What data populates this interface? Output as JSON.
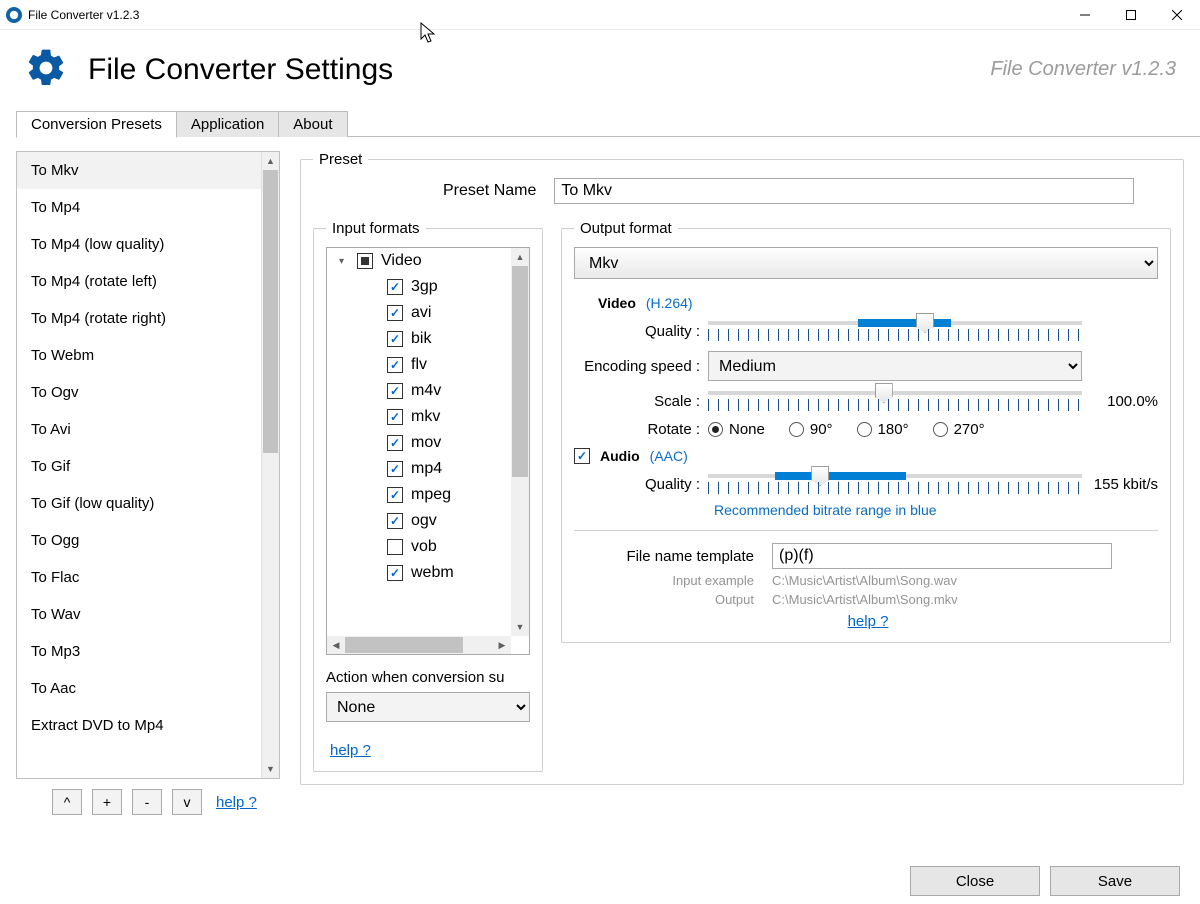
{
  "window": {
    "title": "File Converter v1.2.3"
  },
  "header": {
    "title": "File Converter Settings",
    "version": "File Converter v1.2.3"
  },
  "tabs": {
    "presets": "Conversion Presets",
    "application": "Application",
    "about": "About"
  },
  "presets": {
    "items": [
      "To Mkv",
      "To Mp4",
      "To Mp4 (low quality)",
      "To Mp4 (rotate left)",
      "To Mp4 (rotate right)",
      "To Webm",
      "To Ogv",
      "To Avi",
      "To Gif",
      "To Gif (low quality)",
      "To Ogg",
      "To Flac",
      "To Wav",
      "To Mp3",
      "To Aac",
      "Extract DVD to Mp4"
    ],
    "selected_index": 0,
    "buttons": {
      "up": "^",
      "add": "+",
      "remove": "-",
      "down": "v"
    },
    "help": "help ?"
  },
  "preset_box": {
    "legend": "Preset",
    "name_label": "Preset Name",
    "name_value": "To Mkv",
    "help": "help ?"
  },
  "input_formats": {
    "legend": "Input formats",
    "group": "Video",
    "items": [
      {
        "label": "3gp",
        "checked": true
      },
      {
        "label": "avi",
        "checked": true
      },
      {
        "label": "bik",
        "checked": true
      },
      {
        "label": "flv",
        "checked": true
      },
      {
        "label": "m4v",
        "checked": true
      },
      {
        "label": "mkv",
        "checked": true
      },
      {
        "label": "mov",
        "checked": true
      },
      {
        "label": "mp4",
        "checked": true
      },
      {
        "label": "mpeg",
        "checked": true
      },
      {
        "label": "ogv",
        "checked": true
      },
      {
        "label": "vob",
        "checked": false
      },
      {
        "label": "webm",
        "checked": true
      }
    ],
    "action_label": "Action when conversion su",
    "action_value": "None"
  },
  "output": {
    "legend": "Output format",
    "format": "Mkv",
    "video": {
      "title": "Video",
      "codec": "(H.264)",
      "quality_label": "Quality :",
      "encoding_label": "Encoding speed :",
      "encoding_value": "Medium",
      "scale_label": "Scale :",
      "scale_value": "100.0%",
      "rotate_label": "Rotate :",
      "rotate_options": [
        "None",
        "90°",
        "180°",
        "270°"
      ],
      "rotate_selected": "None"
    },
    "audio": {
      "title": "Audio",
      "codec": "(AAC)",
      "checked": true,
      "quality_label": "Quality :",
      "quality_value": "155 kbit/s",
      "note": "Recommended bitrate range in blue"
    },
    "filename": {
      "label": "File name template",
      "value": "(p)(f)",
      "input_example_label": "Input example",
      "input_example": "C:\\Music\\Artist\\Album\\Song.wav",
      "output_label": "Output",
      "output": "C:\\Music\\Artist\\Album\\Song.mkv",
      "help": "help ?"
    }
  },
  "footer": {
    "close": "Close",
    "save": "Save"
  }
}
